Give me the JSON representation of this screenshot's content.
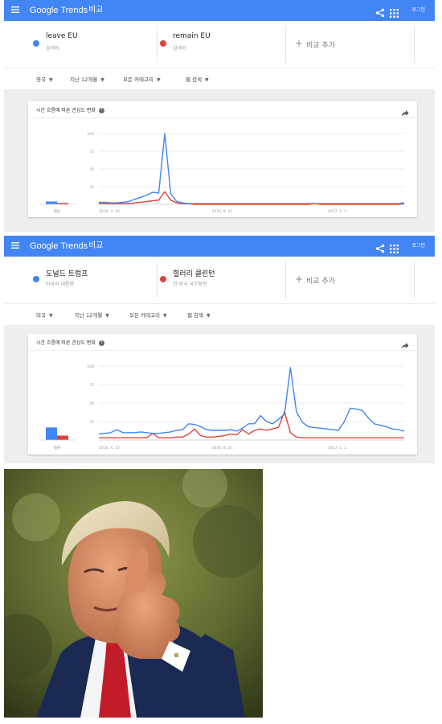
{
  "panels": [
    {
      "header": {
        "logo": "Google Trends",
        "title": "비교",
        "login": "로그인"
      },
      "terms": [
        {
          "name": "leave EU",
          "subtitle": "검색어",
          "color": "#4285f4"
        },
        {
          "name": "remain EU",
          "subtitle": "검색어",
          "color": "#db4437"
        }
      ],
      "add_compare": "비교 추가",
      "filters": [
        "영국",
        "지난 12개월",
        "모든 카테고리",
        "웹 검색"
      ],
      "chart_card": {
        "title": "시간 흐름에 따른 관심도 변화",
        "average_label": "평균"
      },
      "chart_data": {
        "type": "line",
        "x_tick_labels": [
          "2016. 4. 10.",
          "2016. 8. 21.",
          "2017. 1. 1."
        ],
        "y_ticks": [
          100,
          75,
          50,
          25
        ],
        "ylim": [
          0,
          100
        ],
        "averages": [
          4,
          2
        ],
        "series": [
          {
            "name": "leave EU",
            "color": "#4285f4",
            "values": [
              3,
              3,
              2,
              2,
              3,
              4,
              7,
              10,
              13,
              17,
              16,
              100,
              15,
              4,
              2,
              1,
              1,
              1,
              1,
              1,
              1,
              1,
              1,
              1,
              1,
              1,
              1,
              1,
              1,
              1,
              1,
              1,
              1,
              1,
              1,
              1,
              1,
              1,
              1,
              1,
              1,
              1,
              1,
              1,
              1,
              1,
              1,
              1,
              1,
              1,
              1,
              2
            ]
          },
          {
            "name": "remain EU",
            "color": "#db4437",
            "values": [
              1,
              1,
              1,
              1,
              1,
              1,
              2,
              3,
              4,
              5,
              6,
              18,
              6,
              2,
              1,
              1,
              0,
              0,
              0,
              0,
              0,
              0,
              0,
              0,
              0,
              0,
              0,
              0,
              0,
              0,
              0,
              0,
              0,
              0,
              0,
              0,
              1,
              0,
              0,
              0,
              0,
              0,
              0,
              0,
              0,
              0,
              0,
              0,
              0,
              0,
              0,
              1
            ]
          }
        ]
      }
    },
    {
      "header": {
        "logo": "Google Trends",
        "title": "비교",
        "login": "로그인"
      },
      "terms": [
        {
          "name": "도널드 트럼프",
          "subtitle": "미국의 대통령",
          "color": "#4285f4"
        },
        {
          "name": "힐러리 클린턴",
          "subtitle": "전 미국 국무장관",
          "color": "#db4437"
        }
      ],
      "add_compare": "비교 추가",
      "filters": [
        "미국",
        "지난 12개월",
        "모든 카테고리",
        "웹 검색"
      ],
      "chart_card": {
        "title": "시간 흐름에 따른 관심도 변화",
        "average_label": "평균"
      },
      "chart_data": {
        "type": "line",
        "x_tick_labels": [
          "2016. 4. 10.",
          "2016. 8. 21.",
          "2017. 1. 1."
        ],
        "y_ticks": [
          100,
          75,
          50,
          25
        ],
        "ylim": [
          0,
          100
        ],
        "averages": [
          17,
          6
        ],
        "series": [
          {
            "name": "도널드 트럼프",
            "color": "#4285f4",
            "values": [
              8,
              9,
              10,
              14,
              10,
              10,
              10,
              11,
              10,
              9,
              9,
              10,
              11,
              13,
              14,
              22,
              21,
              18,
              14,
              13,
              13,
              13,
              14,
              12,
              16,
              22,
              22,
              33,
              25,
              22,
              28,
              35,
              98,
              38,
              24,
              18,
              17,
              16,
              15,
              14,
              13,
              25,
              43,
              42,
              40,
              30,
              22,
              20,
              18,
              15,
              14,
              12
            ]
          },
          {
            "name": "힐러리 클린턴",
            "color": "#db4437",
            "values": [
              3,
              3,
              3,
              3,
              3,
              3,
              3,
              3,
              3,
              9,
              3,
              3,
              3,
              4,
              4,
              8,
              15,
              6,
              4,
              4,
              5,
              6,
              8,
              7,
              14,
              8,
              13,
              15,
              13,
              15,
              17,
              38,
              10,
              4,
              3,
              3,
              3,
              3,
              3,
              3,
              3,
              3,
              3,
              3,
              3,
              3,
              3,
              3,
              3,
              3,
              3,
              3
            ]
          }
        ]
      }
    }
  ],
  "photo": {
    "suit_color": "#1b2a52",
    "tie_color": "#c21c2a",
    "background_color": "#6a7434"
  }
}
